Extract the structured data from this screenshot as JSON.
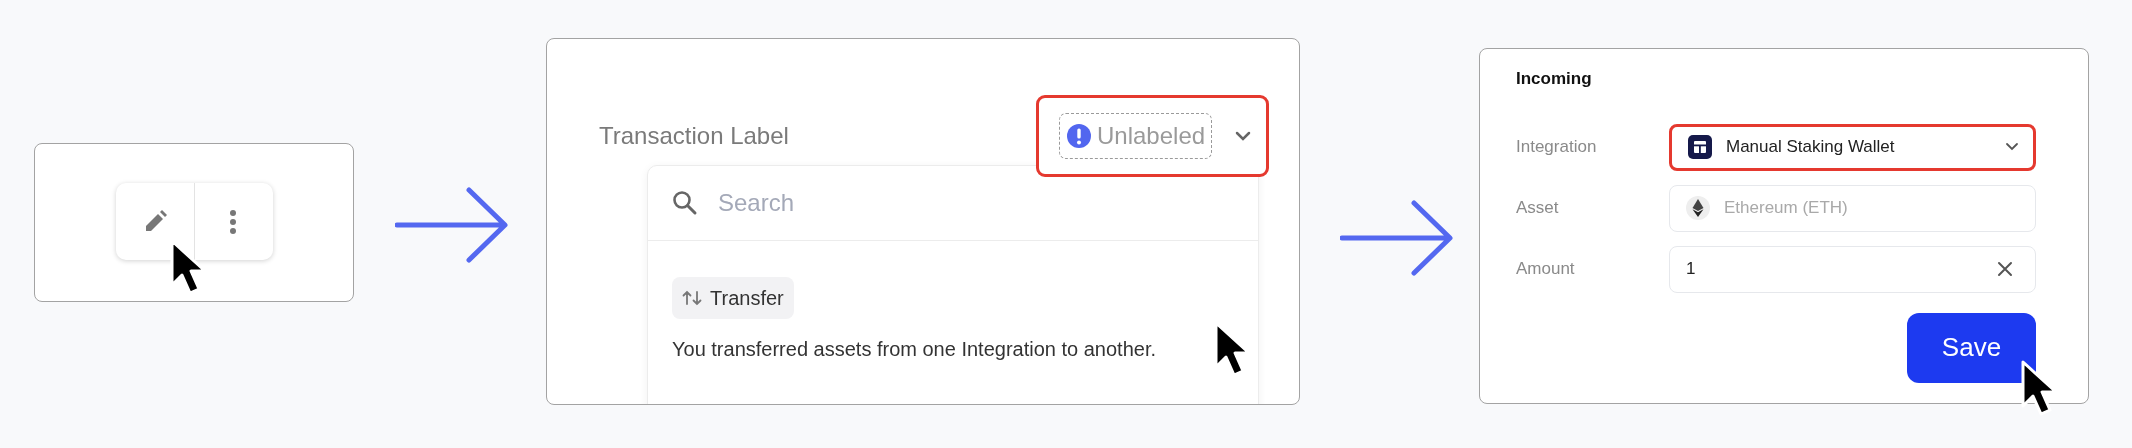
{
  "action_buttons": [
    {
      "kind": "edit"
    },
    {
      "kind": "more"
    }
  ],
  "label_field": {
    "label": "Transaction Label",
    "value": "Unlabeled",
    "highlighted": true
  },
  "label_dropdown": {
    "placeholder": "Search",
    "options": [
      {
        "name": "Transfer",
        "description": "You transferred assets from one Integration to another."
      }
    ]
  },
  "incoming_form": {
    "title": "Incoming",
    "fields": [
      {
        "label": "Integration",
        "kind": "select",
        "value": "Manual Staking Wallet",
        "highlighted": true
      },
      {
        "label": "Asset",
        "kind": "asset",
        "placeholder": "Ethereum (ETH)",
        "highlighted": false
      },
      {
        "label": "Amount",
        "kind": "amount",
        "value": "1",
        "highlighted": false
      }
    ],
    "save_button": "Save"
  }
}
